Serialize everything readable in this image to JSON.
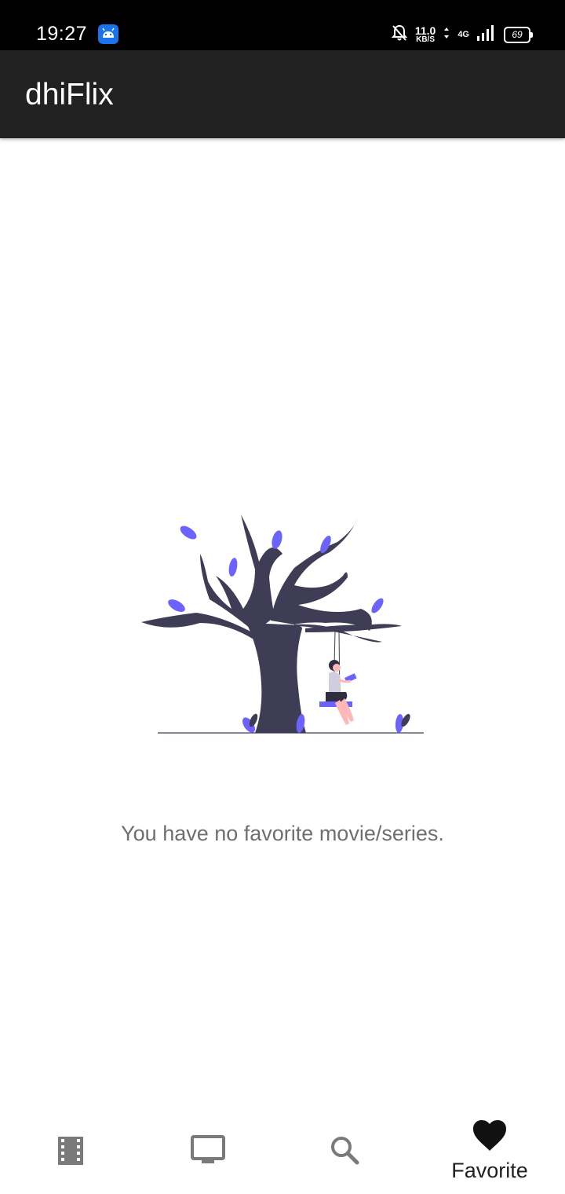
{
  "status_bar": {
    "time": "19:27",
    "net_speed_value": "11.0",
    "net_speed_unit": "KB/S",
    "network_type": "4G",
    "battery": "69",
    "icons": [
      "android-app-icon",
      "bell-off-icon",
      "data-arrows-icon",
      "signal-icon",
      "battery-icon"
    ]
  },
  "app_bar": {
    "title": "dhiFlix",
    "background": "#212121"
  },
  "empty_state": {
    "message": "You have no favorite movie/series.",
    "illustration": "tree-swing-illustration",
    "accent": "#6c63ff",
    "trunk_color": "#3f3d56"
  },
  "bottom_nav": {
    "items": [
      {
        "icon": "film-icon",
        "label": "",
        "selected": false
      },
      {
        "icon": "tv-icon",
        "label": "",
        "selected": false
      },
      {
        "icon": "search-icon",
        "label": "",
        "selected": false
      },
      {
        "icon": "heart-icon",
        "label": "Favorite",
        "selected": true
      }
    ]
  }
}
